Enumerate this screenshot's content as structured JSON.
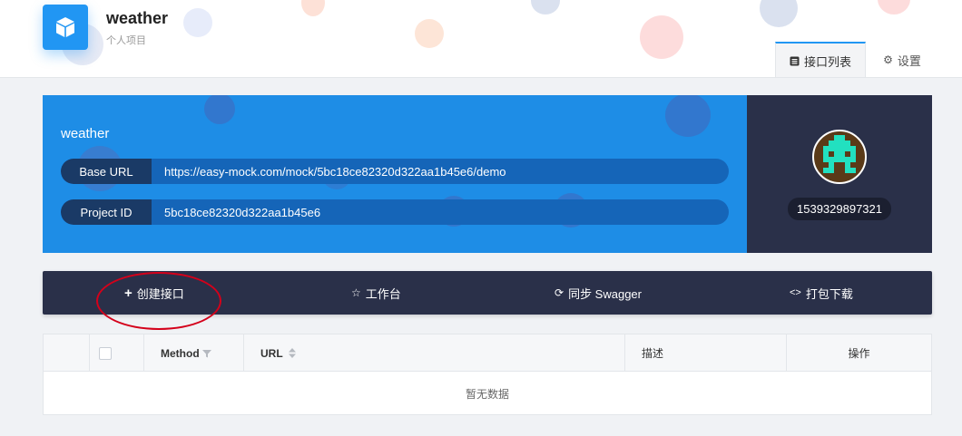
{
  "project": {
    "title": "weather",
    "subtitle": "个人项目"
  },
  "tabs": {
    "api_list": "接口列表",
    "settings": "设置"
  },
  "info": {
    "name": "weather",
    "base_url_label": "Base URL",
    "base_url": "https://easy-mock.com/mock/5bc18ce82320d322aa1b45e6/demo",
    "project_id_label": "Project ID",
    "project_id": "5bc18ce82320d322aa1b45e6"
  },
  "profile": {
    "id": "1539329897321"
  },
  "actions": {
    "create": "创建接口",
    "workbench": "工作台",
    "sync": "同步 Swagger",
    "download": "打包下载"
  },
  "table": {
    "columns": {
      "method": "Method",
      "url": "URL",
      "desc": "描述",
      "ops": "操作"
    },
    "empty": "暂无数据"
  },
  "colors": {
    "accent": "#2196f3",
    "panel_blue": "#1e8de6",
    "dark": "#2a3049",
    "annotation_red": "#d4001a"
  }
}
